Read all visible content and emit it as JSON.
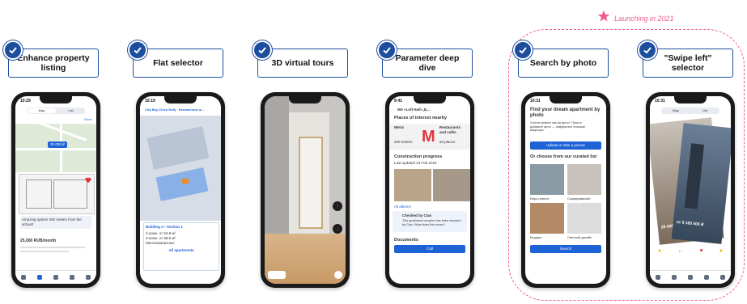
{
  "launch": {
    "label": "Launching in 2021",
    "accent": "#ef5d87"
  },
  "brand_color": "#1d4e9e",
  "features": [
    {
      "title": "Enhance property listing"
    },
    {
      "title": "Flat selector"
    },
    {
      "title": "3D virtual tours"
    },
    {
      "title": "Parameter deep dive"
    },
    {
      "title": "Search by photo"
    },
    {
      "title": "\"Swipe left\" selector"
    }
  ],
  "screens": {
    "listing": {
      "time": "10:29",
      "tab_map": "Map",
      "tab_list": "List",
      "save": "Save",
      "badge": "25 000 ₽",
      "chip": "Amazing option! 300 meters from the school!",
      "price": "25,000 RUB/month"
    },
    "flat": {
      "time": "10:19",
      "title": "City Bay (Сити Бэй) · Неизменное ш...",
      "building": "Building 2 • Section 1",
      "rows": [
        "2-комн. от 64,8 м²",
        "3-комн. от 88,5 м²",
        "Многокомнатные"
      ],
      "link": "All apartments"
    },
    "tour": {},
    "deep": {
      "time": "9:41",
      "title": "ЖК «Loft Hall» Д-...",
      "poi": "Places of interest nearby",
      "cols": [
        "Metro",
        "Restaurants and cafés"
      ],
      "dist": [
        "200 meters",
        "50 places"
      ],
      "progress": "Construction progress",
      "updated": "Last updated 23 Feb 2019",
      "all": "All albums",
      "checked": "Checked by Cian",
      "checked_sub": "This apartment complex has been checked by Cian. What does this mean?",
      "docs": "Documents",
      "call": "Call"
    },
    "photo": {
      "time": "10:31",
      "title": "Find your dream apartment by photo",
      "sub": "Хотите ремонт как на фото? Просто добавьте фото — найдём все похожие квартиры",
      "upload": "Upload or take a picture",
      "curated": "Or choose from our curated list",
      "tiles": [
        "Евро ремонт",
        "Скандинавский",
        "Модерн",
        "Светлый дизайн"
      ],
      "search": "Search"
    },
    "swipe": {
      "time": "10:31",
      "tab_map": "Map",
      "tab_list": "List",
      "price1": "28 000 000 ₽",
      "price2": "от 9 160 000 ₽"
    }
  }
}
